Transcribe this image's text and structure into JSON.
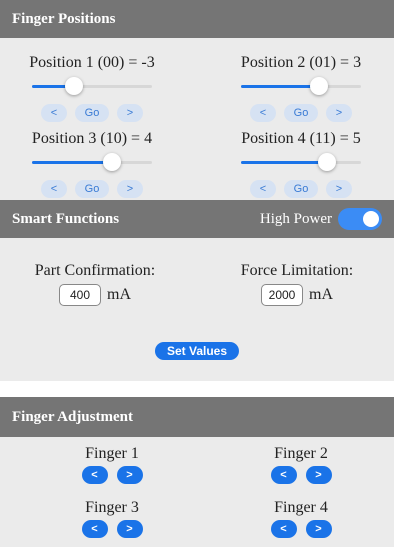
{
  "finger_positions": {
    "title": "Finger Positions",
    "positions": [
      {
        "label": "Position 1 (00) = -3",
        "level": 0.35,
        "btn_left": "<",
        "btn_go": "Go",
        "btn_right": ">"
      },
      {
        "label": "Position 2 (01) = 3",
        "level": 0.65,
        "btn_left": "<",
        "btn_go": "Go",
        "btn_right": ">"
      },
      {
        "label": "Position 3 (10) = 4",
        "level": 0.67,
        "btn_left": "<",
        "btn_go": "Go",
        "btn_right": ">"
      },
      {
        "label": "Position 4 (11) = 5",
        "level": 0.72,
        "btn_left": "<",
        "btn_go": "Go",
        "btn_right": ">"
      }
    ]
  },
  "smart_functions": {
    "title": "Smart Functions",
    "high_power_label": "High Power",
    "high_power_on": true,
    "part_confirmation": {
      "label": "Part Confirmation:",
      "value": "400",
      "unit": "mA"
    },
    "force_limitation": {
      "label": "Force Limitation:",
      "value": "2000",
      "unit": "mA"
    },
    "set_values_label": "Set Values"
  },
  "finger_adjustment": {
    "title": "Finger Adjustment",
    "fingers": [
      {
        "label": "Finger 1",
        "btn_left": "<",
        "btn_right": ">"
      },
      {
        "label": "Finger 2",
        "btn_left": "<",
        "btn_right": ">"
      },
      {
        "label": "Finger 3",
        "btn_left": "<",
        "btn_right": ">"
      },
      {
        "label": "Finger 4",
        "btn_left": "<",
        "btn_right": ">"
      }
    ]
  },
  "colors": {
    "header_bg": "#757575",
    "panel_bg": "#ebebeb",
    "accent": "#1a73e8",
    "pill_bg": "#d6e2f3"
  }
}
